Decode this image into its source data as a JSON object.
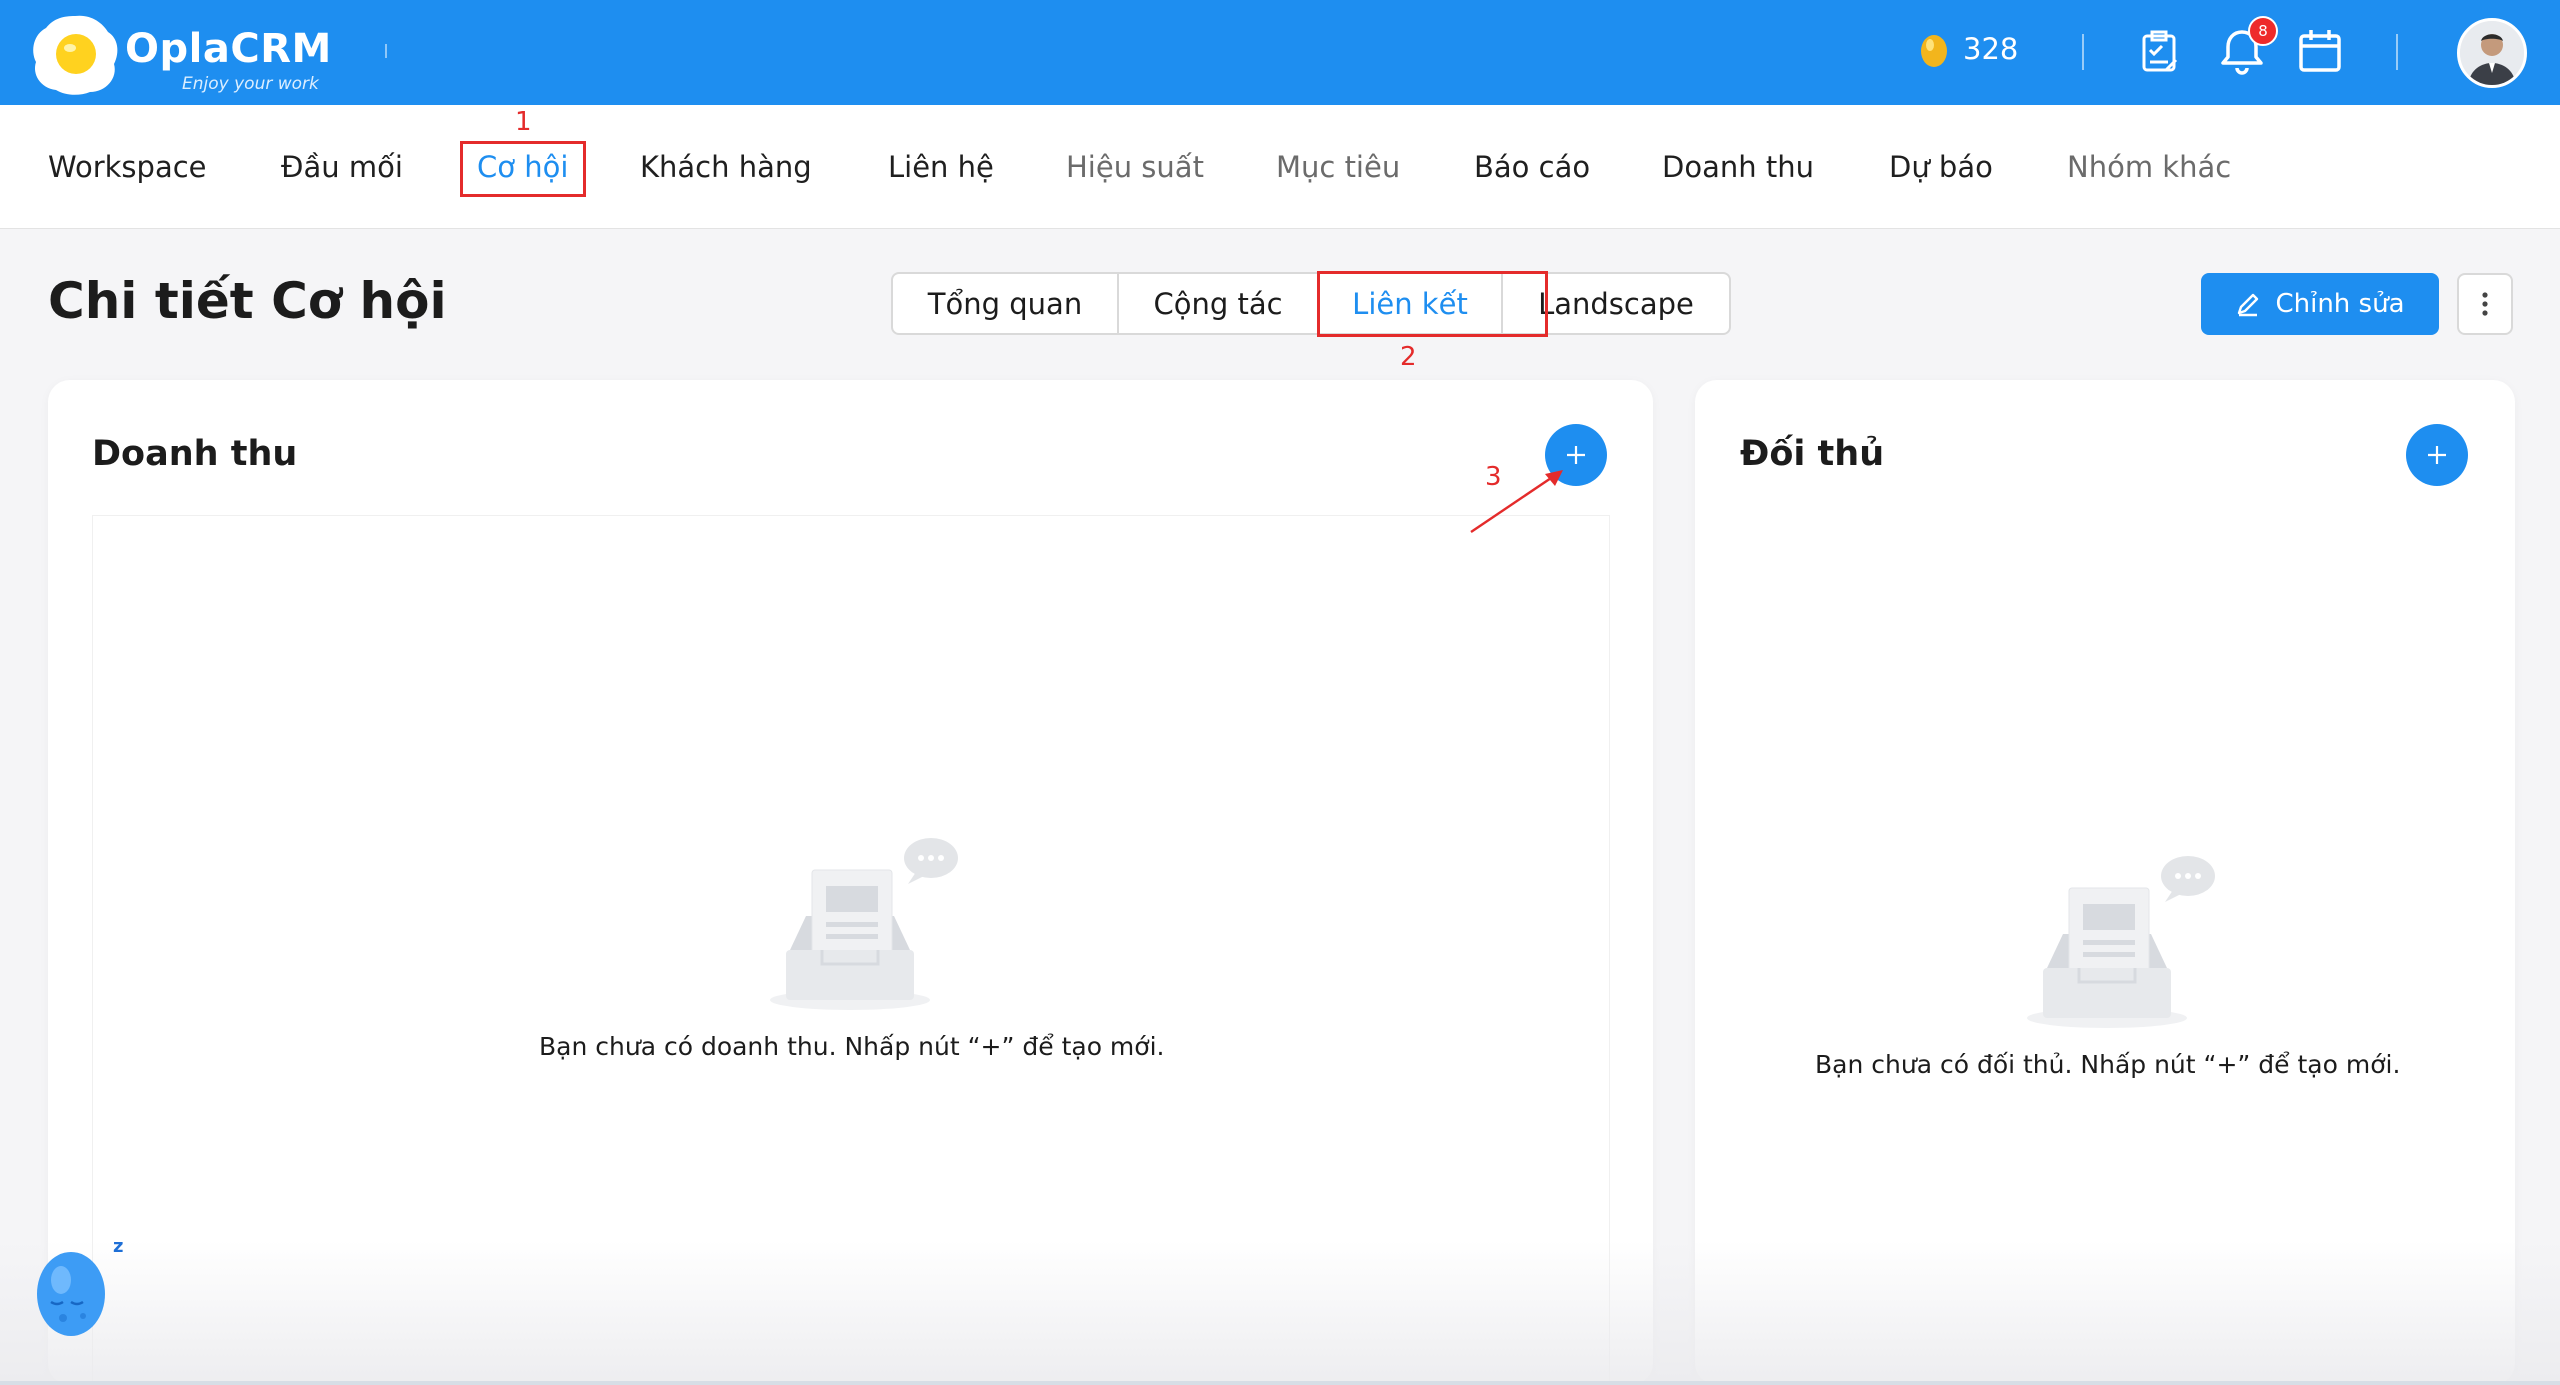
{
  "app": {
    "logo_text": "OplaCRM",
    "tagline": "Enjoy your work",
    "brand_color": "#1e8ef0",
    "accent_red": "#e42b2b"
  },
  "topbar": {
    "coin_value": "328",
    "notification_count": "8",
    "icons": [
      "coin-icon",
      "checklist-icon",
      "bell-icon",
      "calendar-icon",
      "user-avatar"
    ]
  },
  "nav": {
    "items": [
      {
        "label": "Workspace"
      },
      {
        "label": "Đầu mối"
      },
      {
        "label": "Cơ hội"
      },
      {
        "label": "Khách hàng"
      },
      {
        "label": "Liên hệ"
      },
      {
        "label": "Hiệu suất"
      },
      {
        "label": "Mục tiêu"
      },
      {
        "label": "Báo cáo"
      },
      {
        "label": "Doanh thu"
      },
      {
        "label": "Dự báo"
      },
      {
        "label": "Nhóm khác"
      }
    ],
    "active": "Cơ hội"
  },
  "page": {
    "title": "Chi tiết Cơ hội",
    "tabs": [
      {
        "label": "Tổng quan"
      },
      {
        "label": "Cộng tác"
      },
      {
        "label": "Liên kết"
      },
      {
        "label": "Landscape"
      }
    ],
    "active_tab": "Liên kết",
    "edit_label": "Chỉnh sửa"
  },
  "annotations": {
    "step1": "1",
    "step2": "2",
    "step3": "3"
  },
  "revenue_card": {
    "title": "Doanh thu",
    "empty_text": "Bạn chưa có doanh thu. Nhấp nút “+” để tạo mới."
  },
  "competitor_card": {
    "title": "Đối thủ",
    "empty_text": "Bạn chưa có đối thủ. Nhấp nút “+” để tạo mới."
  },
  "floating": {
    "sleep_mark": "z"
  }
}
